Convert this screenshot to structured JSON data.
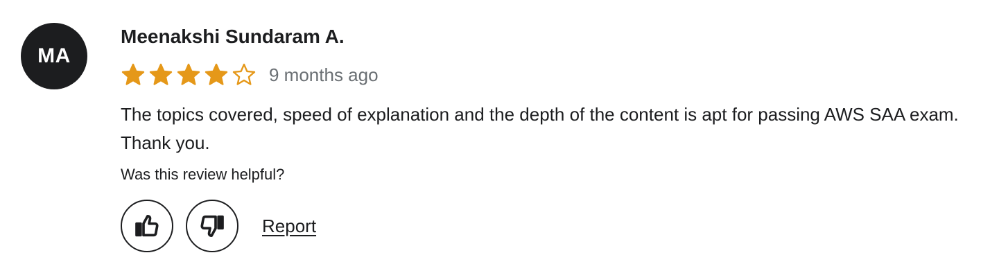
{
  "review": {
    "avatar_initials": "MA",
    "author_name": "Meenakshi Sundaram A.",
    "rating": 4,
    "rating_max": 5,
    "time_ago": "9 months ago",
    "text": "The topics covered, speed of explanation and the depth of the content is apt for passing AWS SAA exam. Thank you.",
    "helpful_prompt": "Was this review helpful?",
    "report_label": "Report"
  },
  "icons": {
    "filled_star": "star-icon",
    "empty_star": "star-outline-icon",
    "thumbs_up": "thumbs-up-icon",
    "thumbs_down": "thumbs-down-icon"
  },
  "colors": {
    "star": "#e59819",
    "avatar_bg": "#1c1d1f",
    "text": "#1c1d1f",
    "muted": "#6a6f73"
  }
}
